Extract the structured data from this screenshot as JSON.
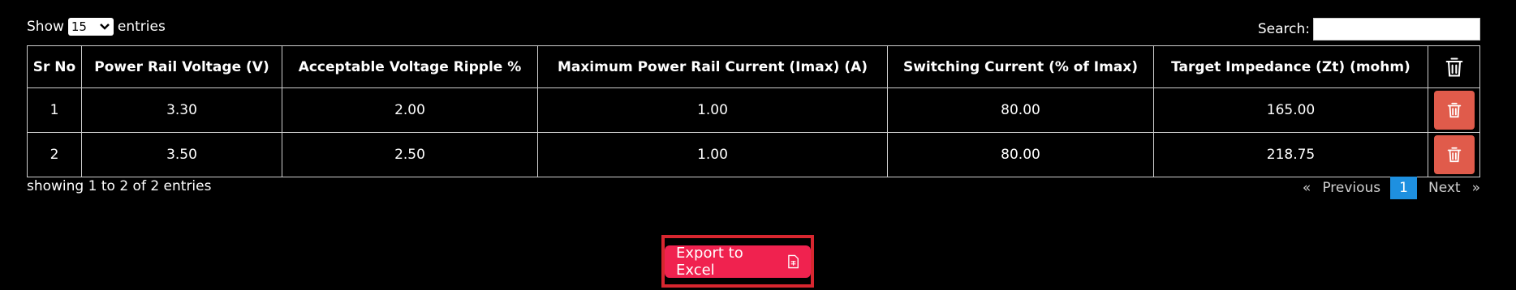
{
  "length_menu": {
    "show_label": "Show",
    "value": "15",
    "entries_label": "entries"
  },
  "search": {
    "label": "Search:",
    "value": ""
  },
  "table": {
    "headers": [
      "Sr No",
      "Power Rail Voltage (V)",
      "Acceptable Voltage Ripple %",
      "Maximum Power Rail Current (Imax) (A)",
      "Switching Current (% of Imax)",
      "Target Impedance (Zt) (mohm)"
    ],
    "rows": [
      [
        "1",
        "3.30",
        "2.00",
        "1.00",
        "80.00",
        "165.00"
      ],
      [
        "2",
        "3.50",
        "2.50",
        "1.00",
        "80.00",
        "218.75"
      ]
    ]
  },
  "info_text": "showing 1 to 2 of 2 entries",
  "pagination": {
    "first": "«",
    "previous": "Previous",
    "current_page": "1",
    "next": "Next",
    "last": "»"
  },
  "export": {
    "label": "Export to Excel"
  },
  "colors": {
    "delete": "#e05b4b",
    "export": "#f0224f",
    "page_active": "#1e90e0",
    "highlight": "#d7262f"
  }
}
